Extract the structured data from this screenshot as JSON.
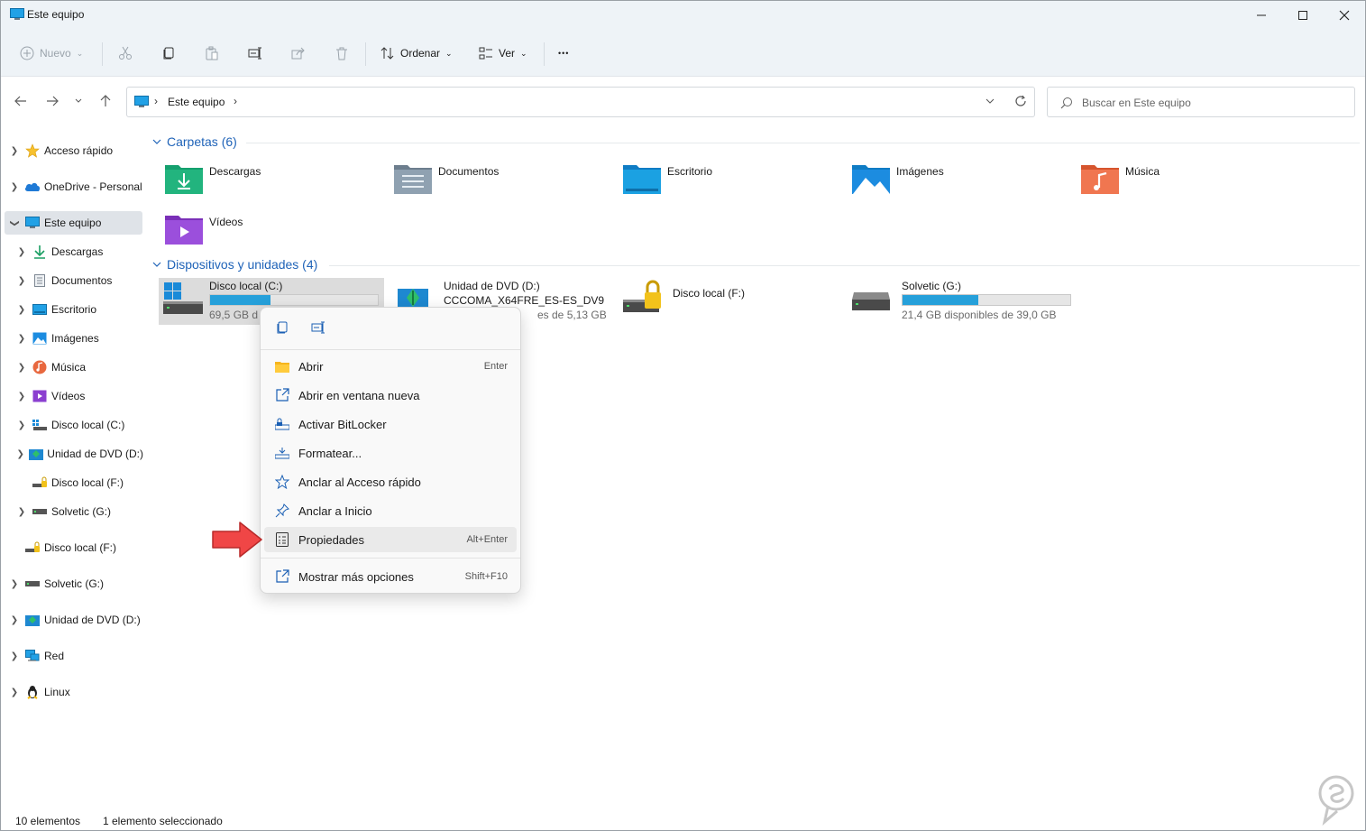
{
  "window": {
    "title": "Este equipo"
  },
  "toolbar": {
    "new_label": "Nuevo",
    "sort_label": "Ordenar",
    "view_label": "Ver",
    "more_label": "•••"
  },
  "address": {
    "path": "Este equipo"
  },
  "search": {
    "placeholder": "Buscar en Este equipo"
  },
  "sidebar": {
    "items": [
      {
        "label": "Acceso rápido",
        "icon": "star-icon"
      },
      {
        "label": "OneDrive - Personal",
        "icon": "onedrive-icon"
      },
      {
        "label": "Este equipo",
        "icon": "computer-icon"
      },
      {
        "label": "Descargas",
        "icon": "downloads-icon"
      },
      {
        "label": "Documentos",
        "icon": "documents-icon"
      },
      {
        "label": "Escritorio",
        "icon": "desktop-icon"
      },
      {
        "label": "Imágenes",
        "icon": "pictures-icon"
      },
      {
        "label": "Música",
        "icon": "music-icon"
      },
      {
        "label": "Vídeos",
        "icon": "videos-icon"
      },
      {
        "label": "Disco local (C:)",
        "icon": "drive-c-icon"
      },
      {
        "label": "Unidad de DVD (D:)",
        "icon": "dvd-icon"
      },
      {
        "label": "Disco local (F:)",
        "icon": "locked-drive-icon"
      },
      {
        "label": "Solvetic (G:)",
        "icon": "drive-icon"
      },
      {
        "label": "Disco local (F:)",
        "icon": "locked-drive-icon"
      },
      {
        "label": "Solvetic (G:)",
        "icon": "drive-icon"
      },
      {
        "label": "Unidad de DVD (D:)",
        "icon": "dvd-icon"
      },
      {
        "label": "Red",
        "icon": "network-icon"
      },
      {
        "label": "Linux",
        "icon": "linux-icon"
      }
    ]
  },
  "content": {
    "folders_header": "Carpetas (6)",
    "devices_header": "Dispositivos y unidades (4)",
    "folders": [
      {
        "name": "Descargas",
        "icon": "downloads-folder-icon"
      },
      {
        "name": "Documentos",
        "icon": "documents-folder-icon"
      },
      {
        "name": "Escritorio",
        "icon": "desktop-folder-icon"
      },
      {
        "name": "Imágenes",
        "icon": "pictures-folder-icon"
      },
      {
        "name": "Música",
        "icon": "music-folder-icon"
      },
      {
        "name": "Vídeos",
        "icon": "videos-folder-icon"
      }
    ],
    "drives": [
      {
        "name": "Disco local (C:)",
        "free": "69,5 GB d",
        "used_fraction": 0.36,
        "icon": "windows-drive-icon"
      },
      {
        "name": "Unidad de DVD (D:)",
        "sub": "CCCOMA_X64FRE_ES-ES_DV9",
        "free": "es de 5,13 GB",
        "icon": "dvd-drive-icon"
      },
      {
        "name": "Disco local (F:)",
        "icon": "locked-drive-icon"
      },
      {
        "name": "Solvetic (G:)",
        "free": "21,4 GB disponibles de 39,0 GB",
        "used_fraction": 0.45,
        "icon": "drive-icon"
      }
    ]
  },
  "context_menu": {
    "items": [
      {
        "label": "Abrir",
        "key": "Enter",
        "icon": "folder-open-icon"
      },
      {
        "label": "Abrir en ventana nueva",
        "key": "",
        "icon": "new-window-icon"
      },
      {
        "label": "Activar BitLocker",
        "key": "",
        "icon": "bitlocker-icon"
      },
      {
        "label": "Formatear...",
        "key": "",
        "icon": "format-icon"
      },
      {
        "label": "Anclar al Acceso rápido",
        "key": "",
        "icon": "star-icon"
      },
      {
        "label": "Anclar a Inicio",
        "key": "",
        "icon": "pin-icon"
      },
      {
        "label": "Propiedades",
        "key": "Alt+Enter",
        "icon": "properties-icon"
      },
      {
        "label": "Mostrar más opciones",
        "key": "Shift+F10",
        "icon": "more-options-icon"
      }
    ]
  },
  "status": {
    "count": "10 elementos",
    "selected": "1 elemento seleccionado"
  },
  "colors": {
    "accent": "#1f63b8",
    "bar_fill": "#26a0da",
    "chrome": "#eef3f7",
    "arrow": "#f04646"
  }
}
